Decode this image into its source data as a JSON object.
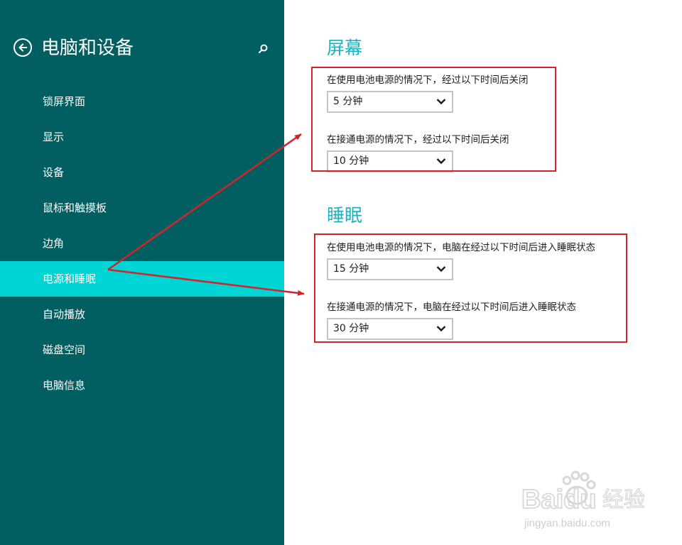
{
  "sidebar": {
    "title": "电脑和设备",
    "items": [
      {
        "label": "锁屏界面",
        "active": false
      },
      {
        "label": "显示",
        "active": false
      },
      {
        "label": "设备",
        "active": false
      },
      {
        "label": "鼠标和触摸板",
        "active": false
      },
      {
        "label": "边角",
        "active": false
      },
      {
        "label": "电源和睡眠",
        "active": true
      },
      {
        "label": "自动播放",
        "active": false
      },
      {
        "label": "磁盘空间",
        "active": false
      },
      {
        "label": "电脑信息",
        "active": false
      }
    ]
  },
  "screen": {
    "heading": "屏幕",
    "battery_label": "在使用电池电源的情况下，经过以下时间后关闭",
    "battery_value": "5 分钟",
    "plugged_label": "在接通电源的情况下，经过以下时间后关闭",
    "plugged_value": "10 分钟"
  },
  "sleep": {
    "heading": "睡眠",
    "battery_label": "在使用电池电源的情况下，电脑在经过以下时间后进入睡眠状态",
    "battery_value": "15 分钟",
    "plugged_label": "在接通电源的情况下，电脑在经过以下时间后进入睡眠状态",
    "plugged_value": "30 分钟"
  },
  "watermark": {
    "brand": "Baidu",
    "suffix": "经验",
    "url": "jingyan.baidu.com"
  },
  "colors": {
    "sidebar_bg": "#015e61",
    "active_item": "#00d5d5",
    "heading": "#1ab4c1",
    "annotation": "#d3242a"
  },
  "icons": {
    "back": "back-arrow-circle-icon",
    "search": "search-icon",
    "dropdown": "chevron-down-icon"
  }
}
